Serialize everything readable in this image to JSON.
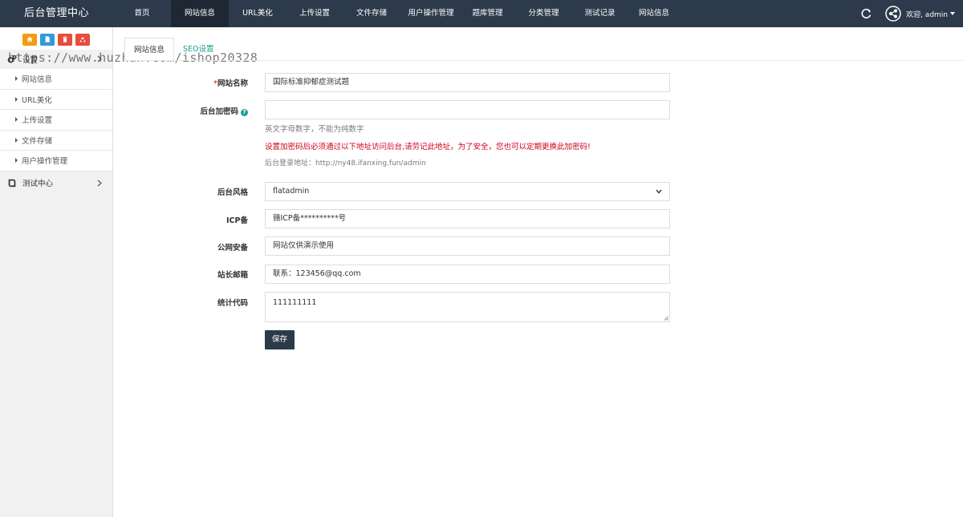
{
  "brand": "后台管理中心",
  "nav": [
    {
      "label": "首页",
      "name": "nav-home",
      "w": 72
    },
    {
      "label": "网站信息",
      "name": "nav-site-info",
      "w": 72,
      "active": true
    },
    {
      "label": "URL美化",
      "name": "nav-url-beautify",
      "w": 72
    },
    {
      "label": "上传设置",
      "name": "nav-upload-settings",
      "w": 70
    },
    {
      "label": "文件存储",
      "name": "nav-file-storage",
      "w": 72
    },
    {
      "label": "用户操作管理",
      "name": "nav-user-ops",
      "w": 76
    },
    {
      "label": "题库管理",
      "name": "nav-question-bank",
      "w": 65
    },
    {
      "label": "分类管理",
      "name": "nav-category",
      "w": 75
    },
    {
      "label": "测试记录",
      "name": "nav-test-records",
      "w": 65
    },
    {
      "label": "网站信息",
      "name": "nav-site-info-2",
      "w": 70
    }
  ],
  "user": {
    "greeting": "欢迎, admin"
  },
  "sidebar": {
    "section1": "设置",
    "items": [
      {
        "label": "网站信息"
      },
      {
        "label": "URL美化"
      },
      {
        "label": "上传设置"
      },
      {
        "label": "文件存储"
      },
      {
        "label": "用户操作管理"
      }
    ],
    "section2": "测试中心"
  },
  "watermark": "https://www.huzhan.com/ishop20328",
  "tabs": {
    "active": "网站信息",
    "inactive": "SEO设置"
  },
  "form": {
    "site_name": {
      "required_mark": "*",
      "label": "网站名称",
      "value": "国际标准抑郁症测试题"
    },
    "admin_key": {
      "label": "后台加密码",
      "value": "",
      "help": "?"
    },
    "hint_format": "英文字母数字，不能为纯数字",
    "hint_warning": "设置加密码后必须通过以下地址访问后台,请劳记此地址，为了安全，您也可以定期更换此加密码!",
    "hint_login": "后台登录地址：http://ny48.ifanxing.fun/admin",
    "admin_style": {
      "label": "后台风格",
      "value": "flatadmin"
    },
    "icp": {
      "label": "ICP备",
      "value": "赣ICP备**********号"
    },
    "police": {
      "label": "公网安备",
      "value": "网站仅供演示使用"
    },
    "email": {
      "label": "站长邮箱",
      "value": "联系：123456@qq.com"
    },
    "stats": {
      "label": "统计代码",
      "value": "111111111"
    },
    "save_label": "保存"
  },
  "colors": {
    "topbar": "#2c3a4b",
    "accent": "#1aa094",
    "warning": "#d0021b"
  }
}
